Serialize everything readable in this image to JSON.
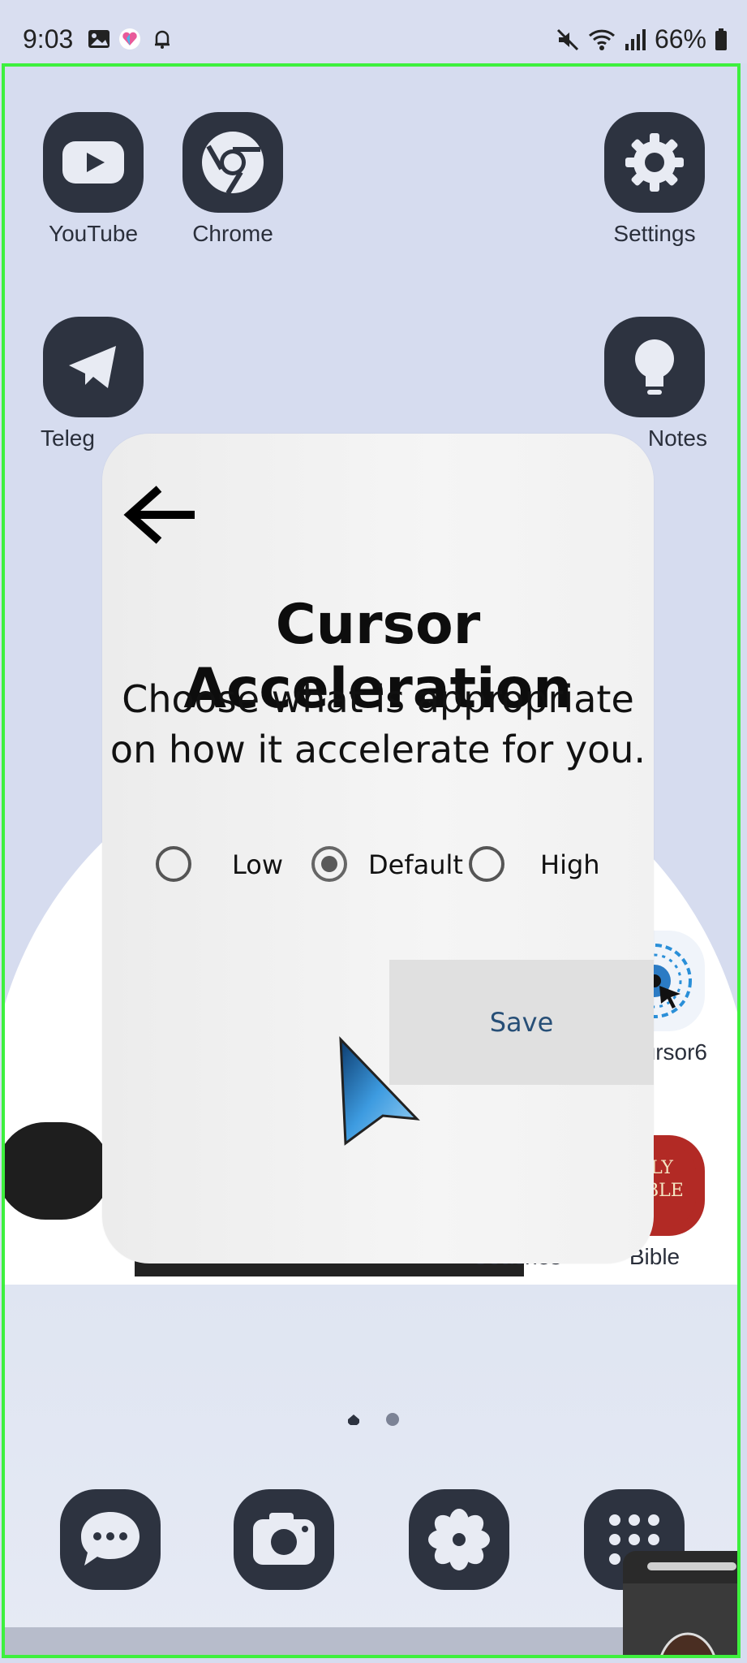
{
  "status_bar": {
    "time": "9:03",
    "battery": "66%",
    "icons": [
      "image-icon",
      "heart-app-icon",
      "bell-icon",
      "mute-icon",
      "wifi-icon",
      "signal-icon",
      "battery-icon"
    ]
  },
  "home": {
    "apps": [
      {
        "label": "YouTube",
        "icon": "youtube-icon"
      },
      {
        "label": "Chrome",
        "icon": "chrome-icon"
      },
      {
        "label": "Settings",
        "icon": "gear-icon"
      },
      {
        "label": "Teleg",
        "icon": "telegram-icon"
      },
      {
        "label": "Notes",
        "icon": "bulb-icon"
      },
      {
        "label": "ursor6",
        "icon": "eye-cursor-icon"
      },
      {
        "label": "Coaches",
        "icon": "coaches-folder-icon"
      },
      {
        "label": "Bible",
        "icon": "bible-icon"
      }
    ],
    "page_indicator": {
      "pages": 2,
      "current": 1
    },
    "dock": [
      "messages-icon",
      "camera-icon",
      "flower-icon",
      "apps-grid-icon"
    ]
  },
  "dialog": {
    "title": "Cursor Acceleration",
    "subtitle_line1": "Choose what is appropriate",
    "subtitle_line2": "on how it accelerate for you.",
    "options": [
      {
        "label": "Low",
        "selected": false
      },
      {
        "label": "Default",
        "selected": true
      },
      {
        "label": "High",
        "selected": false
      }
    ],
    "save_label": "Save"
  },
  "colors": {
    "frame": "#3ef03e",
    "icon_bg": "#2d3340",
    "save_text": "#274f77"
  }
}
